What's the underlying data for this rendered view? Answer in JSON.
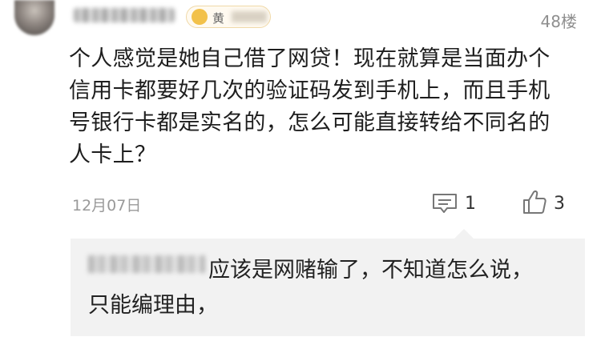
{
  "comment": {
    "badge_text": "黄",
    "floor": "48楼",
    "lines": [
      "个人感觉是她自己借了网贷！现在就算是当面办个",
      "信用卡都要好几次的验证码发到手机上，而且手机",
      "号银行卡都是实名的，怎么可能直接转给不同名的",
      "人卡上？"
    ],
    "date": "12月07日",
    "reply_count": "1",
    "like_count": "3",
    "icons": {
      "reply": "comment-icon",
      "like": "thumbs-up-icon"
    }
  },
  "reply": {
    "line1": "应该是网赌输了，不知道怎么说，",
    "line2": "只能编理由，"
  },
  "colors": {
    "meta_gray": "#999999",
    "reply_background": "#f2f2f2"
  }
}
